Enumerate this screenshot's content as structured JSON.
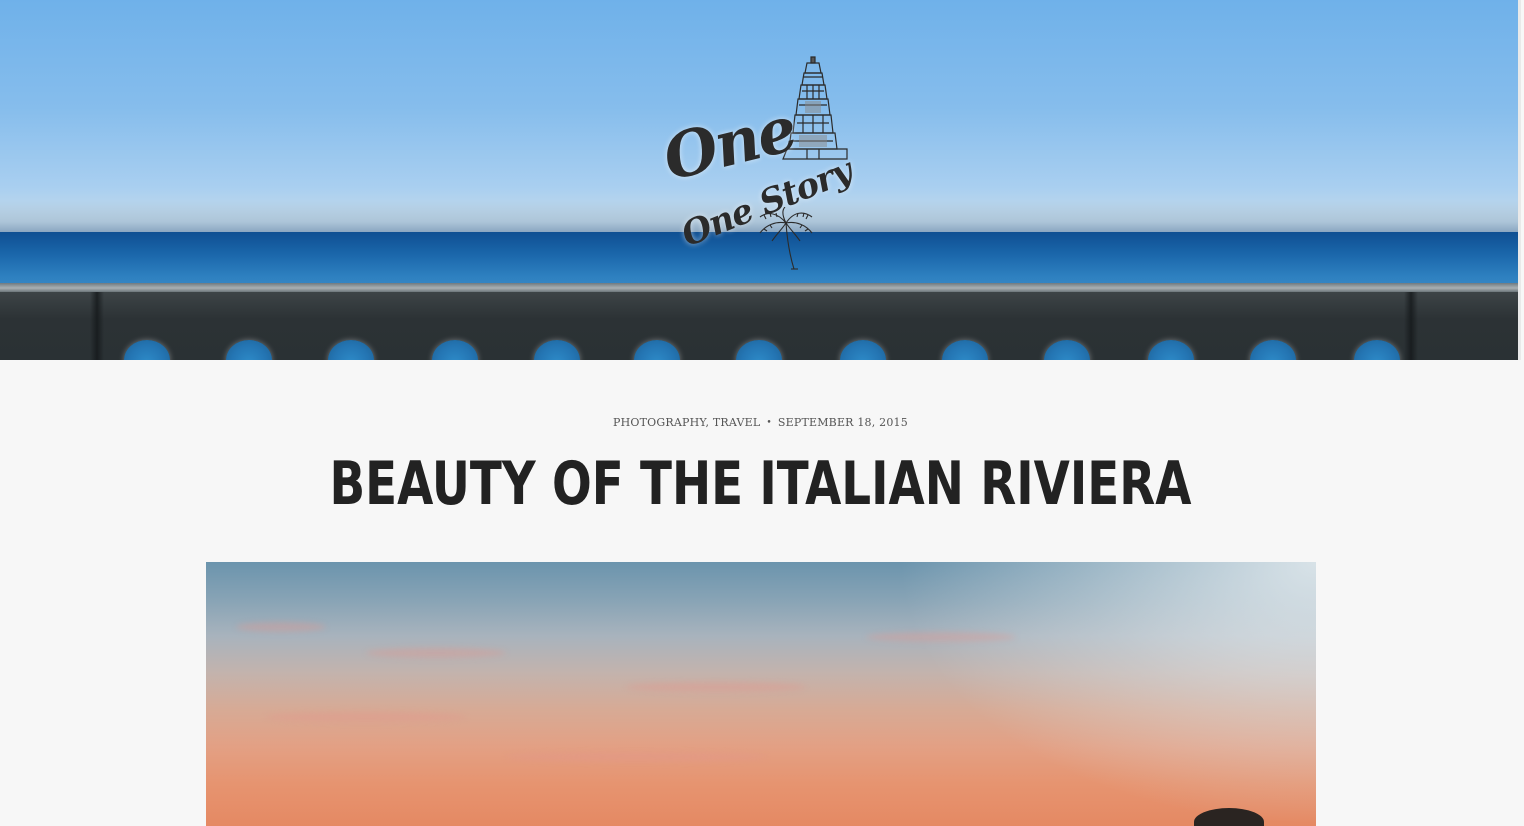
{
  "site": {
    "logo_line1": "One",
    "logo_line2": "One Story",
    "logo_icons": [
      "temple-tower-icon",
      "palm-tree-icon"
    ]
  },
  "post": {
    "categories": [
      "PHOTOGRAPHY",
      "TRAVEL"
    ],
    "category_photography": "PHOTOGRAPHY",
    "category_separator": ",",
    "category_travel": "TRAVEL",
    "meta_separator": "•",
    "date": "SEPTEMBER 18, 2015",
    "title": "BEAUTY OF THE ITALIAN RIVIERA"
  },
  "colors": {
    "page_background": "#f7f7f7",
    "title_text": "#222222",
    "meta_text": "#555555",
    "sky": "#6fb1ea",
    "sea": "#1a66aa"
  }
}
